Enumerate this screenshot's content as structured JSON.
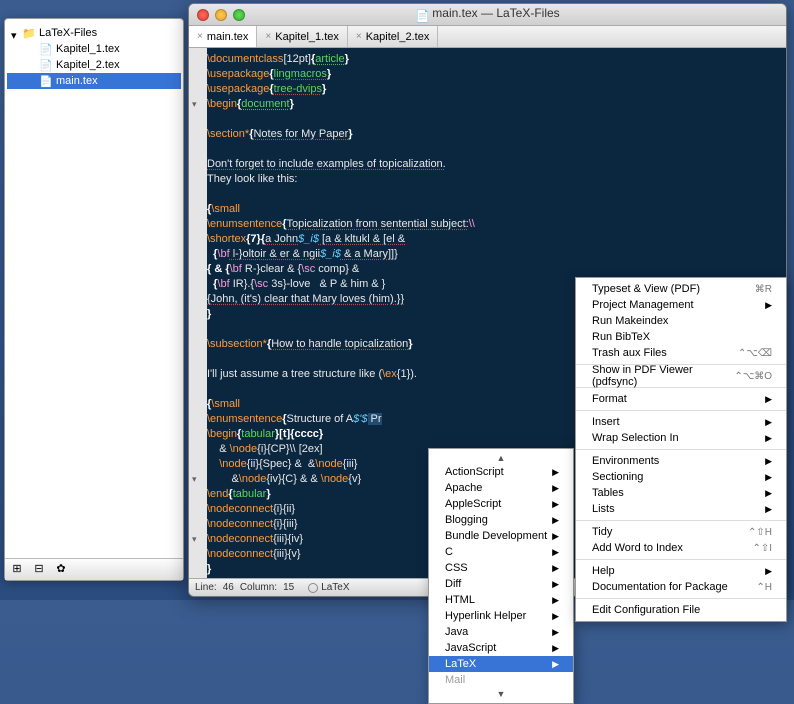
{
  "sidebar": {
    "root": "LaTeX-Files",
    "items": [
      "Kapitel_1.tex",
      "Kapitel_2.tex",
      "main.tex"
    ],
    "selected_index": 2
  },
  "window": {
    "title": "main.tex — LaTeX-Files"
  },
  "tabs": [
    {
      "label": "main.tex",
      "active": true
    },
    {
      "label": "Kapitel_1.tex",
      "active": false
    },
    {
      "label": "Kapitel_2.tex",
      "active": false
    }
  ],
  "status": {
    "line_label": "Line:",
    "line": "46",
    "col_label": "Column:",
    "col": "15",
    "language": "LaTeX"
  },
  "code": {
    "l1a": "\\documentclass",
    "l1b": "[12pt]",
    "l1c": "{",
    "l1d": "article",
    "l1e": "}",
    "l2a": "\\usepackage",
    "l2b": "{",
    "l2c": "lingmacros",
    "l2d": "}",
    "l3a": "\\usepackage",
    "l3b": "{",
    "l3c": "tree-dvips",
    "l3d": "}",
    "l4a": "\\begin",
    "l4b": "{",
    "l4c": "document",
    "l4d": "}",
    "l5a": "\\section*",
    "l5b": "{",
    "l5c": "Notes for My Paper",
    "l5d": "}",
    "l6": "Don't forget to include examples of topicalization.",
    "l7": "They look like this:",
    "l8a": "{",
    "l8b": "\\small",
    "l9a": "\\enumsentence",
    "l9b": "{",
    "l9c": "Topicalization from sentential subject:",
    "l9d": "\\\\",
    "l10a": "\\shortex",
    "l10b": "{7}{",
    "l10c": "a John",
    "l10m": "$_i$",
    "l10d": " [a & kltukl & [el &",
    "l11a": "  {",
    "l11b": "\\bf",
    "l11c": " l-}oltoir & er & ngii",
    "l11m": "$_i$",
    "l11d": " & a Mary]]}",
    "l12a": "{ & {",
    "l12b": "\\bf",
    "l12c": " R-}clear & {",
    "l12d": "\\sc",
    "l12e": " comp} &",
    "l13a": "  {",
    "l13b": "\\bf",
    "l13c": " IR}.{",
    "l13d": "\\sc",
    "l13e": " 3s}-love   & P & him & }",
    "l14": "{John, (it's) clear that Mary loves (him).}}",
    "l15": "}",
    "l16a": "\\subsection*",
    "l16b": "{",
    "l16c": "How to handle topicalization",
    "l16d": "}",
    "l17a": "I'll just assume a tree structure like (",
    "l17b": "\\ex",
    "l17c": "{1}).",
    "l18a": "{",
    "l18b": "\\small",
    "l19a": "\\enumsentence",
    "l19b": "{",
    "l19c": "Structure of A",
    "l19d": "$'$",
    "l19e": " Pr",
    "l20a": "\\begin",
    "l20b": "{",
    "l20c": "tabular",
    "l20d": "}[t]{cccc}",
    "l21a": "    & ",
    "l21b": "\\node",
    "l21c": "{i}{CP}\\\\ [2ex]",
    "l22a": "    ",
    "l22b": "\\node",
    "l22c": "{ii}{Spec} &  &",
    "l22d": "\\node",
    "l22e": "{iii}",
    "l23a": "        &",
    "l23b": "\\node",
    "l23c": "{iv}{C} & & ",
    "l23d": "\\node",
    "l23e": "{v}",
    "l24a": "\\end",
    "l24b": "{",
    "l24c": "tabular",
    "l24d": "}",
    "l25a": "\\nodeconnect",
    "l25b": "{i}{ii}",
    "l26a": "\\nodeconnect",
    "l26b": "{i}{iii}",
    "l27a": "\\nodeconnect",
    "l27b": "{iii}{iv}",
    "l28a": "\\nodeconnect",
    "l28b": "{iii}{v}",
    "l29": "}"
  },
  "lang_menu": {
    "items": [
      "ActionScript",
      "Apache",
      "AppleScript",
      "Blogging",
      "Bundle Development",
      "C",
      "CSS",
      "Diff",
      "HTML",
      "Hyperlink Helper",
      "Java",
      "JavaScript",
      "LaTeX"
    ],
    "highlighted": "LaTeX",
    "more_up": "▲",
    "more_down": "▼",
    "trailing": "Mail"
  },
  "latex_menu": {
    "groups": [
      [
        {
          "label": "Typeset & View (PDF)",
          "shortcut": "⌘R"
        },
        {
          "label": "Project Management",
          "sub": true
        },
        {
          "label": "Run Makeindex"
        },
        {
          "label": "Run BibTeX"
        },
        {
          "label": "Trash aux Files",
          "shortcut": "⌃⌥⌫"
        }
      ],
      [
        {
          "label": "Show in PDF Viewer (pdfsync)",
          "shortcut": "⌃⌥⌘O"
        }
      ],
      [
        {
          "label": "Format",
          "sub": true
        }
      ],
      [
        {
          "label": "Insert",
          "sub": true
        },
        {
          "label": "Wrap Selection In",
          "sub": true
        }
      ],
      [
        {
          "label": "Environments",
          "sub": true
        },
        {
          "label": "Sectioning",
          "sub": true
        },
        {
          "label": "Tables",
          "sub": true
        },
        {
          "label": "Lists",
          "sub": true
        }
      ],
      [
        {
          "label": "Tidy",
          "shortcut": "⌃⇧H"
        },
        {
          "label": "Add Word to Index",
          "shortcut": "⌃⇧I"
        }
      ],
      [
        {
          "label": "Help",
          "sub": true
        },
        {
          "label": "Documentation for Package",
          "shortcut": "⌃H"
        }
      ],
      [
        {
          "label": "Edit Configuration File"
        }
      ]
    ]
  }
}
